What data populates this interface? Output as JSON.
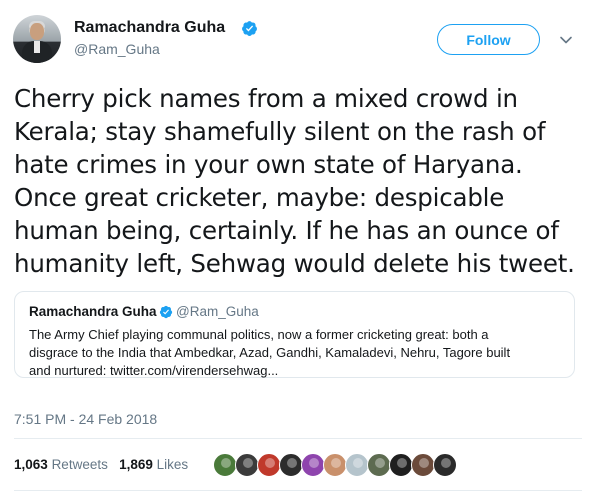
{
  "author": {
    "display_name": "Ramachandra Guha",
    "handle": "@Ram_Guha",
    "verified": true
  },
  "follow_button": {
    "label": "Follow"
  },
  "menu": {
    "icon": "chevron-down-icon"
  },
  "tweet": {
    "lines": [
      "Cherry pick names from a mixed crowd in",
      "Kerala; stay shamefully silent on the rash of",
      "hate crimes in your own state of Haryana.",
      "Once great cricketer, maybe: despicable",
      "human being, certainly. If he has an ounce of",
      "humanity left, Sehwag would delete his tweet."
    ]
  },
  "quoted_tweet": {
    "display_name": "Ramachandra Guha",
    "handle": "@Ram_Guha",
    "lines": [
      "The Army Chief playing communal politics, now a former cricketing great: both a",
      "disgrace to the India that Ambedkar, Azad, Gandhi, Kamaladevi, Nehru, Tagore built",
      "and nurtured: twitter.com/virendersehwag..."
    ]
  },
  "timestamp": "7:51 PM - 24 Feb 2018",
  "stats": {
    "retweets_count": "1,063",
    "retweets_label": "Retweets",
    "likes_count": "1,869",
    "likes_label": "Likes"
  },
  "likers": [
    {
      "name": "liker-avatar-1",
      "color": "#4a7a3a"
    },
    {
      "name": "liker-avatar-2",
      "color": "#3b3b3b"
    },
    {
      "name": "liker-avatar-3",
      "color": "#c0392b"
    },
    {
      "name": "liker-avatar-4",
      "color": "#2c2c2c"
    },
    {
      "name": "liker-avatar-5",
      "color": "#8e44ad"
    },
    {
      "name": "liker-avatar-6",
      "color": "#c9906b"
    },
    {
      "name": "liker-avatar-7",
      "color": "#b5c4cc"
    },
    {
      "name": "liker-avatar-8",
      "color": "#5d6b50"
    },
    {
      "name": "liker-avatar-9",
      "color": "#1f1f1f"
    },
    {
      "name": "liker-avatar-10",
      "color": "#6b4a3a"
    },
    {
      "name": "liker-avatar-11",
      "color": "#2a2a2a"
    }
  ],
  "colors": {
    "accent": "#1da1f2",
    "text": "#14171a",
    "secondary": "#657786",
    "border": "#e1e8ed"
  }
}
